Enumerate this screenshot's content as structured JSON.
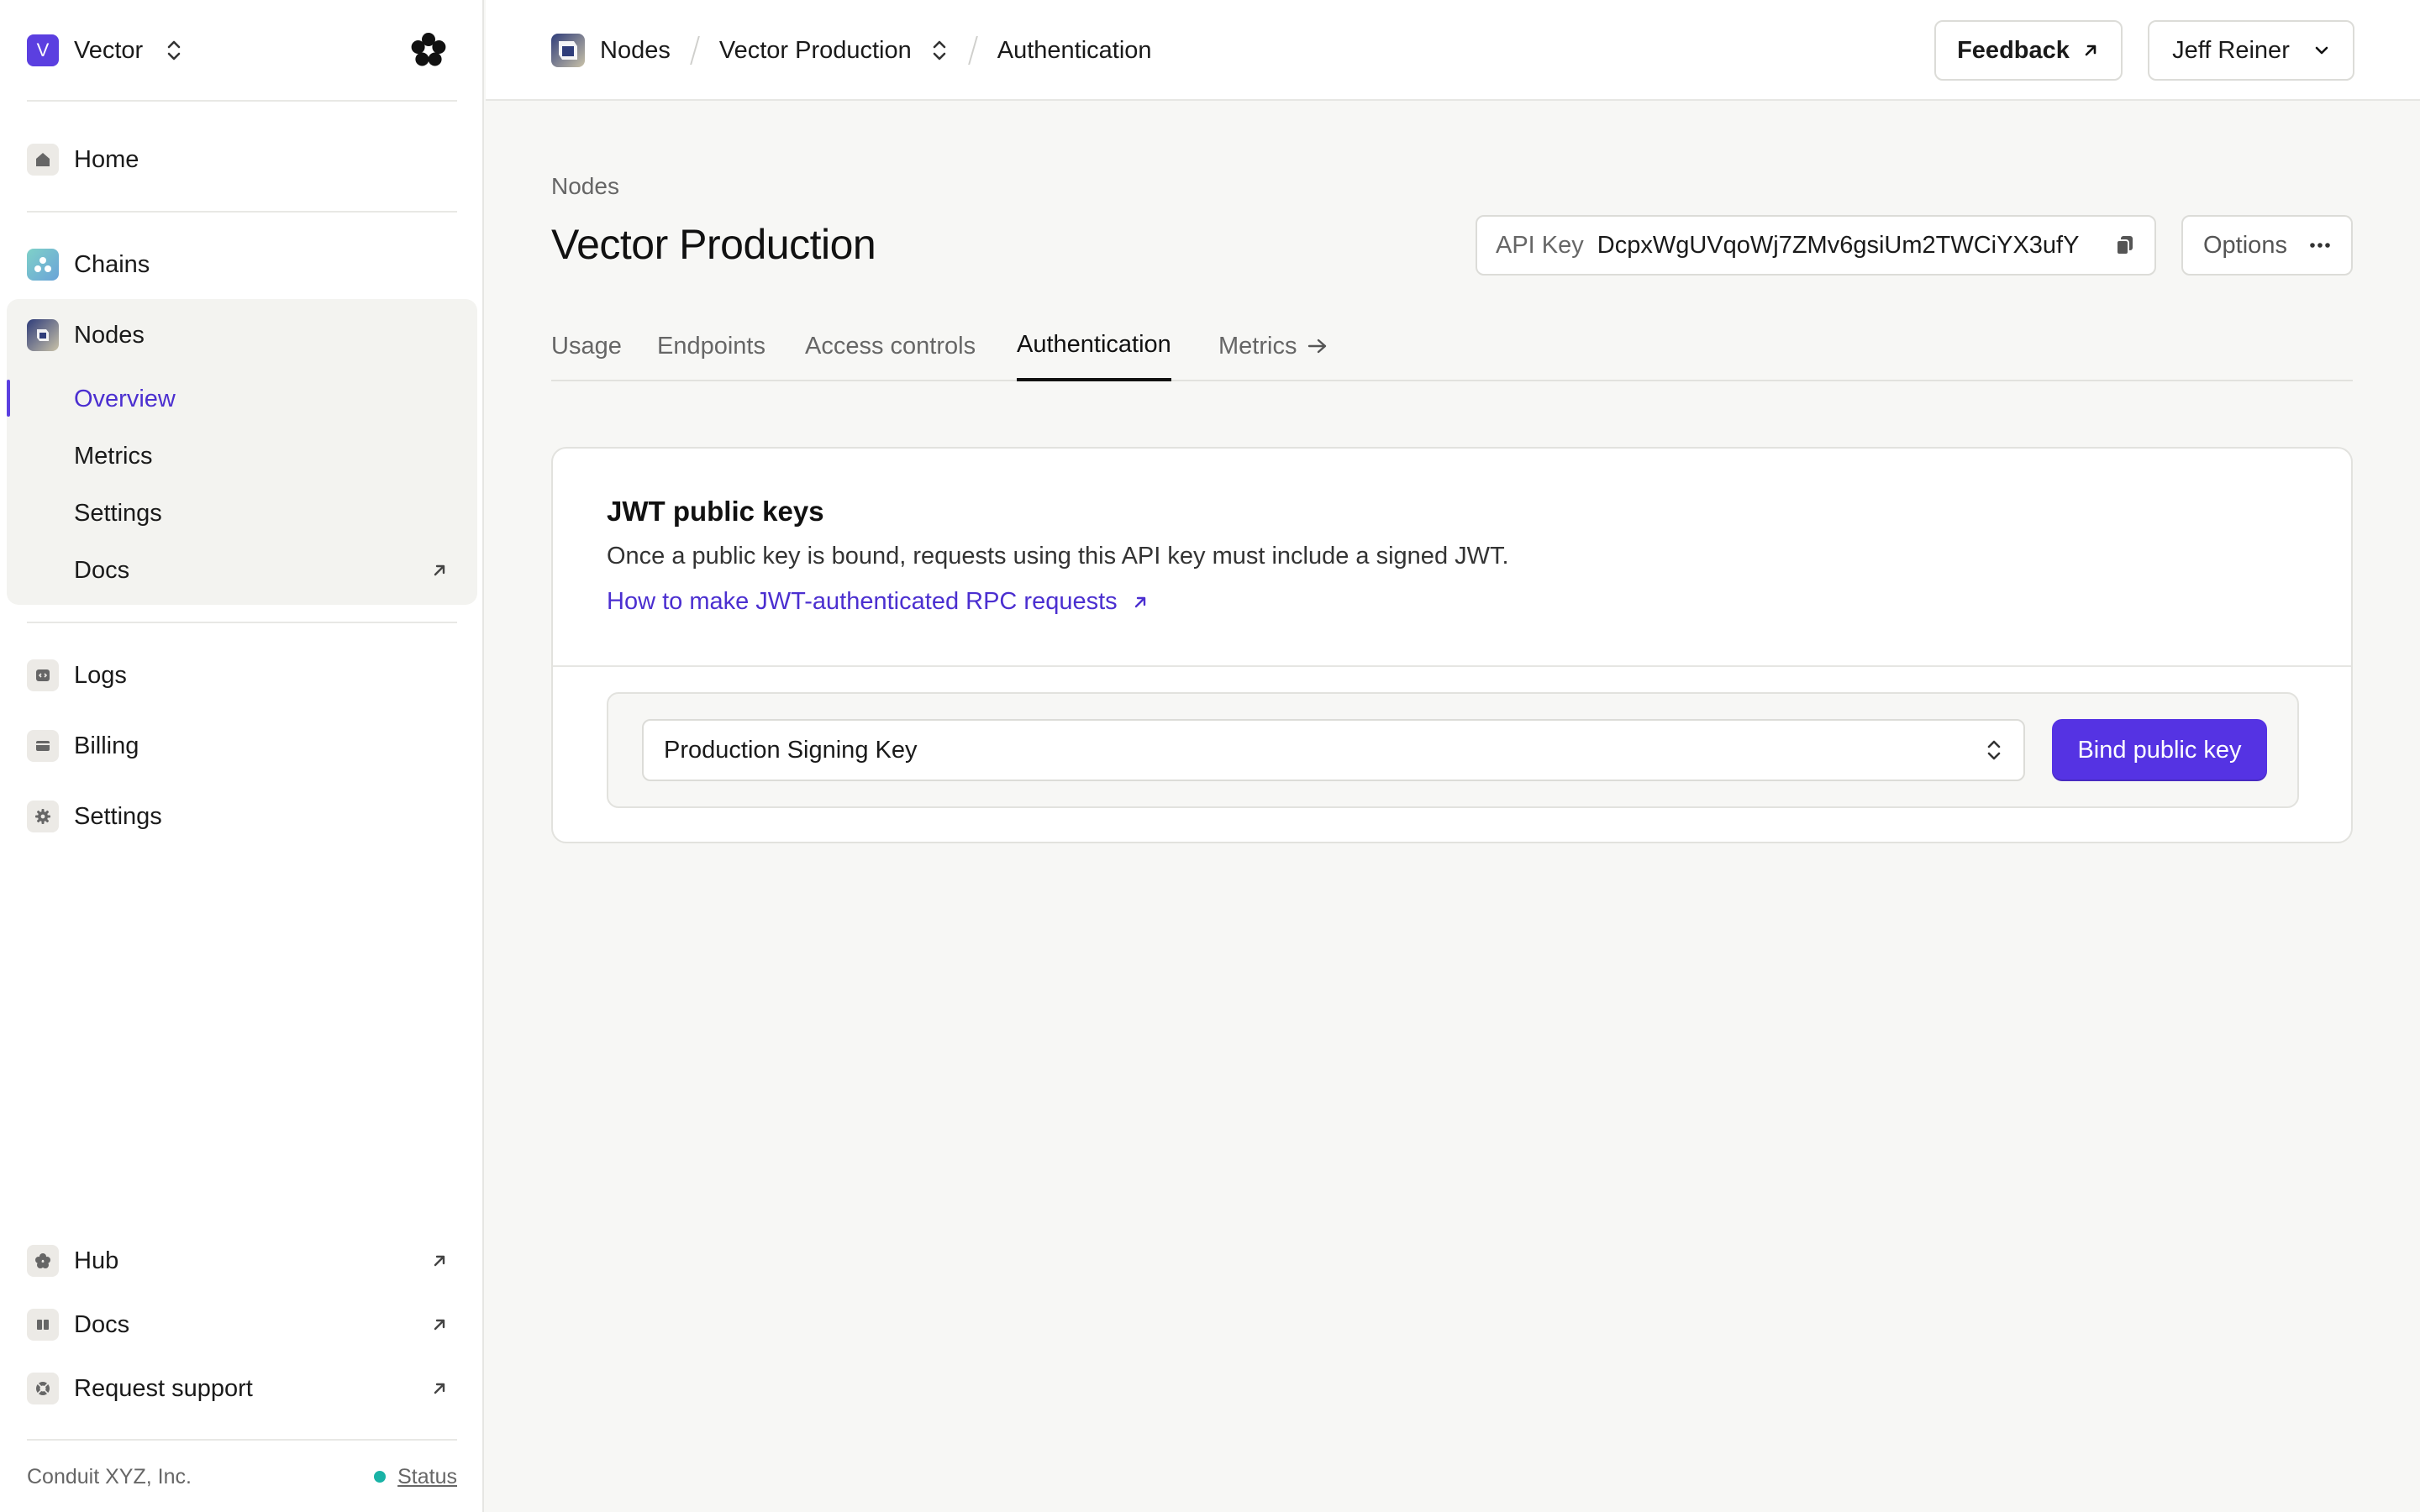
{
  "sidebar": {
    "org": {
      "initial": "V",
      "name": "Vector"
    },
    "home": {
      "label": "Home"
    },
    "chains": {
      "label": "Chains"
    },
    "nodes": {
      "label": "Nodes",
      "items": [
        {
          "label": "Overview",
          "active": true
        },
        {
          "label": "Metrics"
        },
        {
          "label": "Settings"
        },
        {
          "label": "Docs",
          "external": true
        }
      ]
    },
    "logs": {
      "label": "Logs"
    },
    "billing": {
      "label": "Billing"
    },
    "settings": {
      "label": "Settings"
    },
    "hub": {
      "label": "Hub"
    },
    "docs": {
      "label": "Docs"
    },
    "support": {
      "label": "Request support"
    },
    "footer": {
      "company": "Conduit XYZ, Inc.",
      "status": "Status"
    }
  },
  "header": {
    "breadcrumbs": [
      "Nodes",
      "Vector Production",
      "Authentication"
    ],
    "feedback_label": "Feedback",
    "user_name": "Jeff Reiner"
  },
  "page": {
    "eyebrow": "Nodes",
    "title": "Vector Production",
    "api_key_label": "API Key",
    "api_key_value": "DcpxWgUVqoWj7ZMv6gsiUm2TWCiYX3ufY",
    "options_label": "Options",
    "tabs": [
      {
        "label": "Usage"
      },
      {
        "label": "Endpoints"
      },
      {
        "label": "Access controls"
      },
      {
        "label": "Authentication",
        "active": true
      },
      {
        "label": "Metrics"
      }
    ]
  },
  "jwt": {
    "title": "JWT public keys",
    "description": "Once a public key is bound, requests using this API key must include a signed JWT.",
    "link_label": "How to make JWT-authenticated RPC requests",
    "selected_key": "Production Signing Key",
    "bind_label": "Bind public key"
  },
  "colors": {
    "accent": "#5533e3",
    "link": "#4b2fd0",
    "status": "#19b3a6"
  }
}
